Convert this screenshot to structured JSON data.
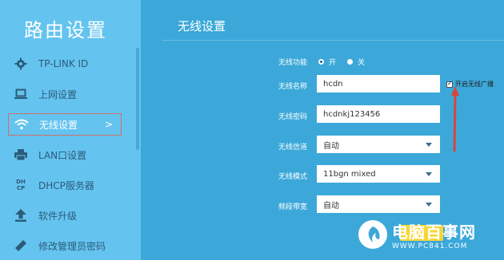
{
  "sidebar": {
    "title": "路由设置",
    "items": [
      {
        "label": "TP-LINK ID"
      },
      {
        "label": "上网设置"
      },
      {
        "label": "无线设置",
        "chevron": ">"
      },
      {
        "label": "LAN口设置"
      },
      {
        "label": "DHCP服务器",
        "icon_text": "DH CP"
      },
      {
        "label": "软件升级"
      },
      {
        "label": "修改管理员密码"
      }
    ]
  },
  "main": {
    "title": "无线设置",
    "wireless_function": {
      "label": "无线功能",
      "on_label": "开",
      "off_label": "关",
      "selected": "开"
    },
    "ssid": {
      "label": "无线名称",
      "value": "hcdn"
    },
    "broadcast": {
      "label": "开启无线广播",
      "checked": true
    },
    "password": {
      "label": "无线密码",
      "value": "hcdnkj123456"
    },
    "channel": {
      "label": "无线信道",
      "value": "自动"
    },
    "mode": {
      "label": "无线模式",
      "value": "11bgn mixed"
    },
    "bandwidth": {
      "label": "频段带宽",
      "value": "自动"
    }
  },
  "watermark": {
    "name": "电脑百事网",
    "url": "WWW.PC841.COM"
  },
  "colors": {
    "background": "#3ba8d9",
    "sidebar": "#64c4ef",
    "highlight_border": "#c9706a",
    "arrow": "#d9453c",
    "save_button": "#f5d63a"
  },
  "icons": [
    "gear-icon",
    "laptop-icon",
    "wifi-icon",
    "printer-icon",
    "dhcp-icon",
    "upload-icon",
    "pencil-icon",
    "watermark-logo-icon"
  ]
}
